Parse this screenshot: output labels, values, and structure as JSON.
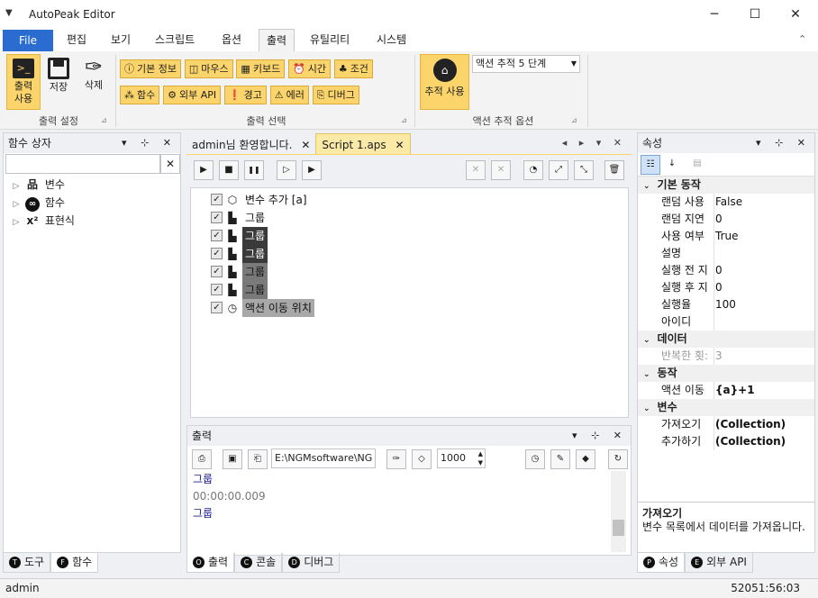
{
  "window": {
    "title": "AutoPeak Editor",
    "qa_glyph": "▼",
    "min": "─",
    "max": "☐",
    "close": "✕"
  },
  "menu_tabs": [
    {
      "label": "File"
    },
    {
      "label": "편집"
    },
    {
      "label": "보기"
    },
    {
      "label": "스크립트"
    },
    {
      "label": "옵션"
    },
    {
      "label": "출력"
    },
    {
      "label": "유틸리티"
    },
    {
      "label": "시스템"
    }
  ],
  "ribbon": {
    "collapse_glyph": "⌃",
    "group1": {
      "label": "출력 설정",
      "print_use": "출력\n사용",
      "save": "저장",
      "delete": "삭제"
    },
    "group2": {
      "label": "출력 선택",
      "row1": [
        {
          "icon": "info-icon",
          "glyph": "ⓘ",
          "label": "기본 정보"
        },
        {
          "icon": "mouse-icon",
          "glyph": "◫",
          "label": "마우스"
        },
        {
          "icon": "keyboard-icon",
          "glyph": "▦",
          "label": "키보드"
        },
        {
          "icon": "clock-icon",
          "glyph": "⏰",
          "label": "시간"
        },
        {
          "icon": "condition-icon",
          "glyph": "♣",
          "label": "조건"
        }
      ],
      "row2": [
        {
          "icon": "function-icon",
          "glyph": "⁂",
          "label": "함수"
        },
        {
          "icon": "gear-icon",
          "glyph": "⚙",
          "label": "외부 API"
        },
        {
          "icon": "warning-icon",
          "glyph": "❗",
          "label": "경고"
        },
        {
          "icon": "error-icon",
          "glyph": "⚠",
          "label": "에러"
        },
        {
          "icon": "debug-icon",
          "glyph": "⎘",
          "label": "디버그"
        }
      ]
    },
    "group3": {
      "label": "액션 추적 옵션",
      "track_use": "추적 사용",
      "track_select": "액션 추적 5 단계",
      "launcher": "⊿"
    }
  },
  "left_panel": {
    "title": "함수 상자",
    "search_placeholder": "",
    "clear_glyph": "✕",
    "pbtns": "▾ ⊹ ✕",
    "items": [
      {
        "icon": "variable-icon",
        "glyph": "品",
        "label": "변수"
      },
      {
        "icon": "function-icon",
        "glyph": "∞",
        "label": "함수"
      },
      {
        "icon": "expression-icon",
        "glyph": "x²",
        "label": "표현식"
      }
    ],
    "tabs": [
      {
        "circle": "T",
        "label": "도구"
      },
      {
        "circle": "F",
        "label": "함수"
      }
    ]
  },
  "doc_tabs": [
    {
      "label": "admin님 환영합니다.",
      "close": "✕"
    },
    {
      "label": "Script 1.aps",
      "close": "✕"
    }
  ],
  "doc_controls": "◂ ▸ ▾ ✕",
  "script_toolbar": {
    "play": "▶",
    "stop": "■",
    "pause": "❚❚",
    "step": "▷",
    "stepend": "▶",
    "x1": "✕",
    "x2": "✕",
    "circle": "◔",
    "expand": "⤢",
    "collapse": "⤡",
    "delete": "🗑"
  },
  "script_rows": [
    {
      "checked": "✓",
      "icon": "variable-add-icon",
      "glyph": "⬡",
      "label": "변수 추가 [a]",
      "indent": 0,
      "style": "plain"
    },
    {
      "checked": "✓",
      "icon": "group-icon",
      "glyph": "▙",
      "label": "그룹",
      "indent": 0,
      "style": "plain"
    },
    {
      "checked": "✓",
      "icon": "group-icon",
      "glyph": "▙",
      "label": "그룹",
      "indent": 0,
      "style": "dark"
    },
    {
      "checked": "✓",
      "icon": "group-icon",
      "glyph": "▙",
      "label": "그룹",
      "indent": 0,
      "style": "dark"
    },
    {
      "checked": "✓",
      "icon": "group-icon",
      "glyph": "▙",
      "label": "그룹",
      "indent": 0,
      "style": "mid"
    },
    {
      "checked": "✓",
      "icon": "group-icon",
      "glyph": "▙",
      "label": "그룹",
      "indent": 0,
      "style": "mid"
    },
    {
      "checked": "✓",
      "icon": "action-move-icon",
      "glyph": "◷",
      "label": "액션 이동 위치",
      "indent": 0,
      "style": "light"
    }
  ],
  "output": {
    "title": "출력",
    "pbtns": "▾ ⊹ ✕",
    "path": "E:\\NGMsoftware\\NG",
    "number": "1000",
    "lines": [
      {
        "text": "그룹",
        "color": "#1a1a8c"
      },
      {
        "text": "00:00:00.009",
        "color": "#777777"
      },
      {
        "text": "그룹",
        "color": "#1a1a8c"
      }
    ],
    "tabs": [
      {
        "circle": "O",
        "label": "출력"
      },
      {
        "circle": "C",
        "label": "콘솔"
      },
      {
        "circle": "D",
        "label": "디버그"
      }
    ]
  },
  "properties": {
    "title": "속성",
    "pbtns": "▾ ⊹ ✕",
    "categories": [
      {
        "name": "기본 동작",
        "rows": [
          {
            "name": "랜덤 사용",
            "value": "False"
          },
          {
            "name": "랜덤 지연",
            "value": "0"
          },
          {
            "name": "사용 여부",
            "value": "True"
          },
          {
            "name": "설명",
            "value": ""
          },
          {
            "name": "실행 전 지",
            "value": "0"
          },
          {
            "name": "실행 후 지",
            "value": "0"
          },
          {
            "name": "실행율",
            "value": "100"
          },
          {
            "name": "아이디",
            "value": ""
          }
        ]
      },
      {
        "name": "데이터",
        "rows": [
          {
            "name": "반복한 횟:",
            "value": "3",
            "muted": true
          }
        ]
      },
      {
        "name": "동작",
        "rows": [
          {
            "name": "액션 이동",
            "value": "{a}+1",
            "bold": true
          }
        ]
      },
      {
        "name": "변수",
        "rows": [
          {
            "name": "가져오기",
            "value": "(Collection)",
            "bold": true
          },
          {
            "name": "추가하기",
            "value": "(Collection)",
            "bold": true
          }
        ]
      }
    ],
    "help_title": "가져오기",
    "help_text": "변수 목록에서 데이터를 가져옵니다.",
    "tabs": [
      {
        "circle": "P",
        "label": "속성"
      },
      {
        "circle": "E",
        "label": "외부 API"
      }
    ]
  },
  "status": {
    "user": "admin",
    "time": "52051:56:03"
  }
}
